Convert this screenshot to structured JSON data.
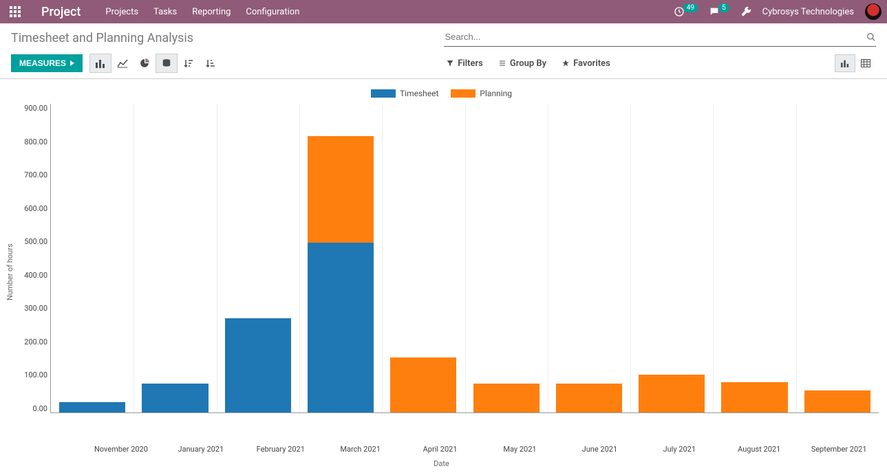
{
  "navbar": {
    "brand": "Project",
    "menu": [
      "Projects",
      "Tasks",
      "Reporting",
      "Configuration"
    ],
    "activity_badge": "49",
    "messages_badge": "5",
    "company": "Cybrosys Technologies"
  },
  "control": {
    "breadcrumb": "Timesheet and Planning Analysis",
    "search_placeholder": "Search...",
    "measures_label": "MEASURES",
    "filters_label": "Filters",
    "groupby_label": "Group By",
    "favorites_label": "Favorites"
  },
  "legend": {
    "timesheet": "Timesheet",
    "planning": "Planning"
  },
  "axes": {
    "ylabel": "Number of hours",
    "xlabel": "Date"
  },
  "chart_data": {
    "type": "bar",
    "stacked": true,
    "title": "Timesheet and Planning Analysis",
    "xlabel": "Date",
    "ylabel": "Number of hours",
    "ylim": [
      0,
      900
    ],
    "ytick_step": 100,
    "categories": [
      "November 2020",
      "January 2021",
      "February 2021",
      "March 2021",
      "April 2021",
      "May 2021",
      "June 2021",
      "July 2021",
      "August 2021",
      "September 2021"
    ],
    "series": [
      {
        "name": "Timesheet",
        "color": "#1f77b4",
        "values": [
          30,
          85,
          275,
          495,
          0,
          0,
          0,
          0,
          0,
          0
        ]
      },
      {
        "name": "Planning",
        "color": "#ff7f0e",
        "values": [
          0,
          0,
          0,
          310,
          160,
          85,
          85,
          110,
          88,
          65
        ]
      }
    ]
  }
}
